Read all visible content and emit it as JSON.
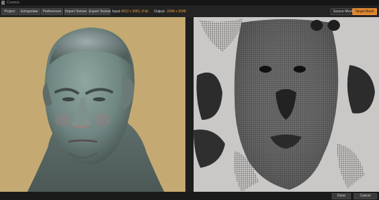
{
  "window": {
    "title": "Cosmos"
  },
  "toolbar": {
    "project_label": "Project",
    "extrapolate_label": "Extrapolate",
    "preferences_label": "Preferences",
    "import_texture_label": "Import Texture",
    "export_texture_label": "Export Texture",
    "input_label": "Input:",
    "input_value": "4012 x 3081, 8 bit",
    "output_label": "Output:",
    "output_value": "2048 x 2048",
    "source_mesh_label": "Source Mesh",
    "target_mesh_label": "Target Mesh",
    "active_mode": "Target Mesh",
    "accent_color": "#e0852e"
  },
  "viewports": {
    "left": {
      "content": "3D head render",
      "background_color": "#c4aa72"
    },
    "right": {
      "content": "UV wireframe layout",
      "background_color": "#c9c8c7"
    }
  },
  "footer": {
    "done_label": "Done",
    "cancel_label": "Cancel"
  }
}
